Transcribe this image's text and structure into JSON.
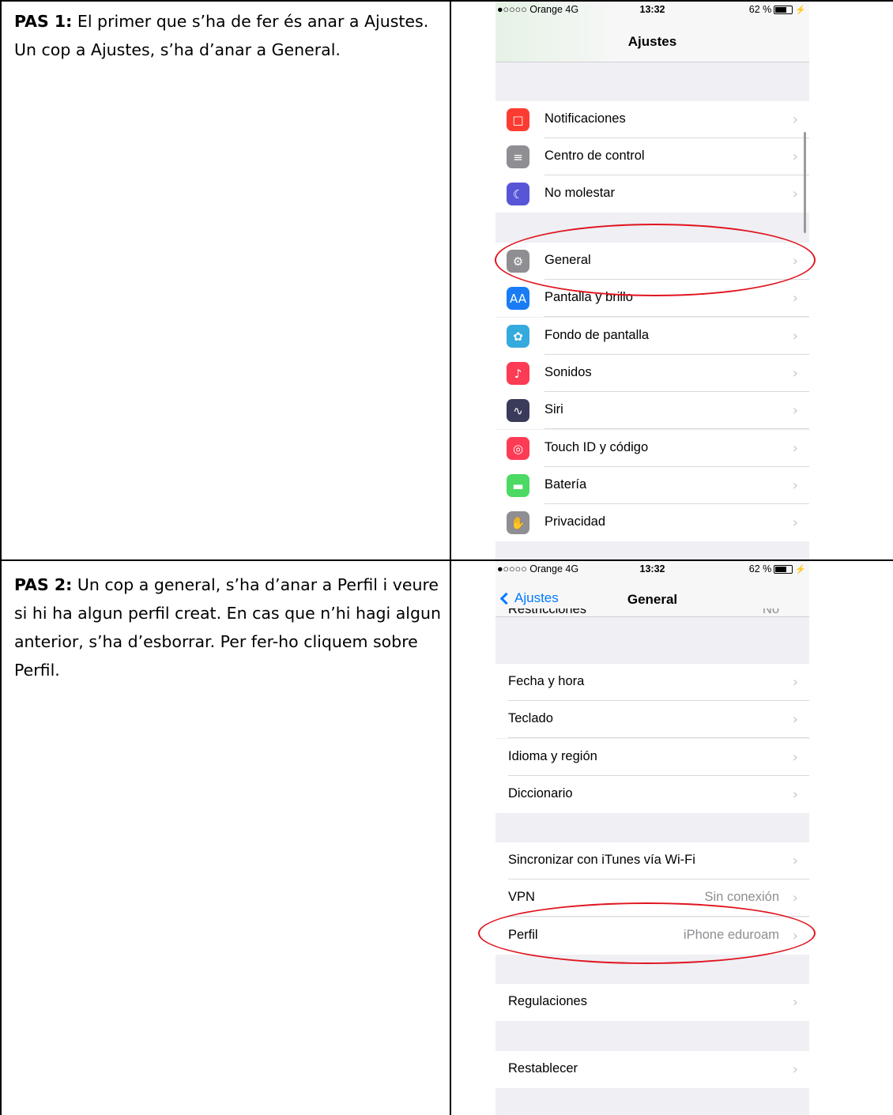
{
  "step1": {
    "step_label": "PAS 1:",
    "text": " El primer que s’ha de fer és anar a Ajustes. Un cop a Ajustes, s’ha d’anar a General."
  },
  "step2": {
    "step_label": "PAS 2:",
    "text": " Un cop a general, s’ha d’anar a Perfil i veure si hi ha algun perfil creat. En cas que n’hi hagi algun anterior, s’ha d’esborrar. Per fer-ho cliquem sobre Perfil."
  },
  "statusbar": {
    "carrier": "●○○○○ Orange  4G",
    "time": "13:32",
    "battery": "62 %"
  },
  "screen1": {
    "title": "Ajustes",
    "items": [
      {
        "label": "Notificaciones",
        "icon": "notifications-icon",
        "color": "#fd3b31"
      },
      {
        "label": "Centro de control",
        "icon": "control-center-icon",
        "color": "#8e8e93"
      },
      {
        "label": "No molestar",
        "icon": "moon-icon",
        "color": "#5856d6"
      },
      {
        "label": "General",
        "icon": "gear-icon",
        "color": "#8e8e93"
      },
      {
        "label": "Pantalla y brillo",
        "icon": "display-icon",
        "color": "#1a7cf5"
      },
      {
        "label": "Fondo de pantalla",
        "icon": "wallpaper-icon",
        "color": "#35aadc"
      },
      {
        "label": "Sonidos",
        "icon": "speaker-icon",
        "color": "#fd3b55"
      },
      {
        "label": "Siri",
        "icon": "siri-icon",
        "color": "#3a3a5a"
      },
      {
        "label": "Touch ID y código",
        "icon": "fingerprint-icon",
        "color": "#fd3b55"
      },
      {
        "label": "Batería",
        "icon": "battery-icon",
        "color": "#4cd964"
      },
      {
        "label": "Privacidad",
        "icon": "hand-icon",
        "color": "#8e8e93"
      }
    ]
  },
  "screen2": {
    "back_label": "Ajustes",
    "title": "General",
    "partial_item": "Restricciones",
    "partial_value": "No",
    "items": [
      {
        "label": "Fecha y hora",
        "value": ""
      },
      {
        "label": "Teclado",
        "value": ""
      },
      {
        "label": "Idioma y región",
        "value": ""
      },
      {
        "label": "Diccionario",
        "value": ""
      },
      {
        "label": "Sincronizar con iTunes vía Wi-Fi",
        "value": ""
      },
      {
        "label": "VPN",
        "value": "Sin conexión"
      },
      {
        "label": "Perfil",
        "value": "iPhone eduroam"
      },
      {
        "label": "Regulaciones",
        "value": ""
      },
      {
        "label": "Restablecer",
        "value": ""
      }
    ]
  },
  "colors": {
    "highlight": "#e0141e",
    "ios_blue": "#007aff",
    "group_bg": "#efeff4"
  }
}
